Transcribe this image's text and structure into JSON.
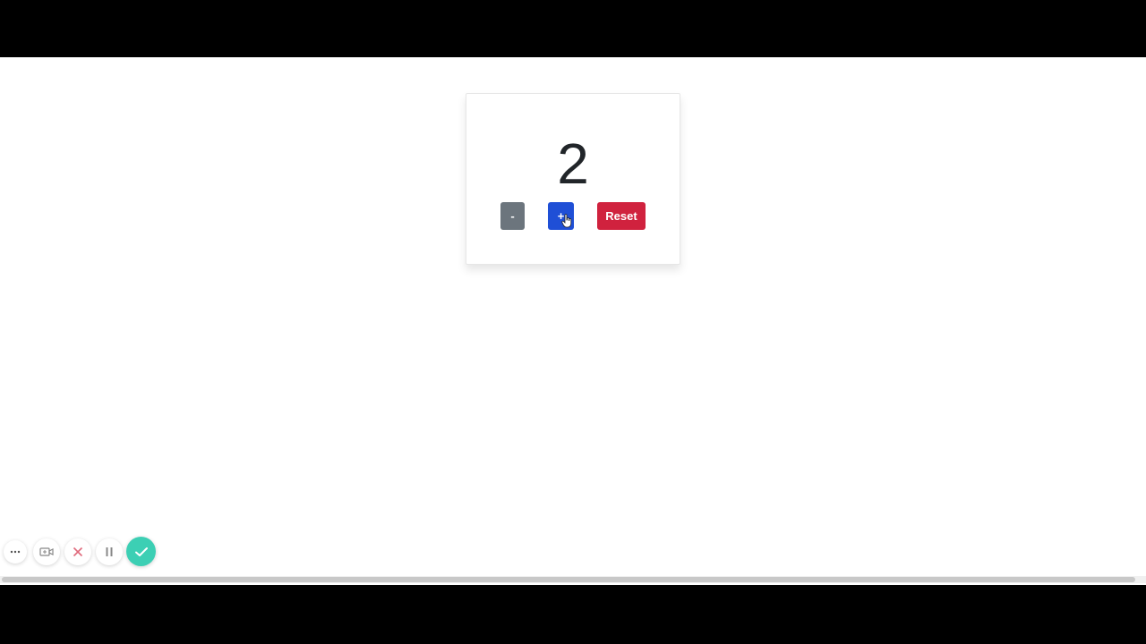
{
  "counter": {
    "value": "2",
    "decrement_label": "-",
    "increment_label": "+",
    "reset_label": "Reset"
  },
  "colors": {
    "decrement": "#6c757d",
    "increment": "#1f4fd6",
    "reset": "#d0223e",
    "done": "#3ccfb4"
  },
  "recorder_toolbar": {
    "icons": [
      "more-icon",
      "camera-icon",
      "close-icon",
      "pause-icon",
      "check-icon"
    ]
  }
}
